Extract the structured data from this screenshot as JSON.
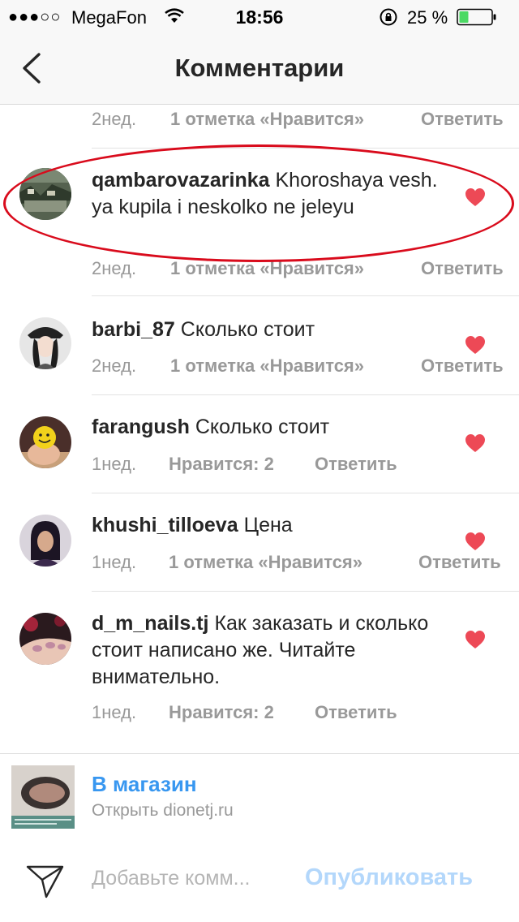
{
  "status_bar": {
    "signal": "●●●○○",
    "carrier": "MegaFon",
    "time": "18:56",
    "battery_percent": "25 %",
    "battery_color": "#4cd964"
  },
  "nav": {
    "title": "Комментарии",
    "back_icon": "chevron-left-icon"
  },
  "top_meta": {
    "time": "2нед.",
    "likes": "1 отметка «Нравится»",
    "reply": "Ответить"
  },
  "comments": [
    {
      "username": "qambarovazarinka",
      "text": "Khoroshaya vesh. ya kupila i neskolko ne jeleyu",
      "time": "2нед.",
      "likes": "1 отметка «Нравится»",
      "reply": "Ответить",
      "highlighted": true
    },
    {
      "username": "barbi_87",
      "text": "Сколько стоит",
      "time": "2нед.",
      "likes": "1 отметка «Нравится»",
      "reply": "Ответить"
    },
    {
      "username": "farangush",
      "text": "Сколько стоит",
      "time": "1нед.",
      "likes": "Нравится: 2",
      "reply": "Ответить"
    },
    {
      "username": "khushi_tilloeva",
      "text": "Цена",
      "time": "1нед.",
      "likes": "1 отметка «Нравится»",
      "reply": "Ответить"
    },
    {
      "username": "d_m_nails.tj",
      "text": "Как заказать и сколько стоит написано же. Читайте внимательно.",
      "time": "1нед.",
      "likes": "Нравится: 2",
      "reply": "Ответить"
    }
  ],
  "heart_color": "#ed4956",
  "shop": {
    "title": "В магазин",
    "subtitle": "Открыть dionetj.ru"
  },
  "input": {
    "placeholder": "Добавьте комм...",
    "publish_label": "Опубликовать"
  }
}
